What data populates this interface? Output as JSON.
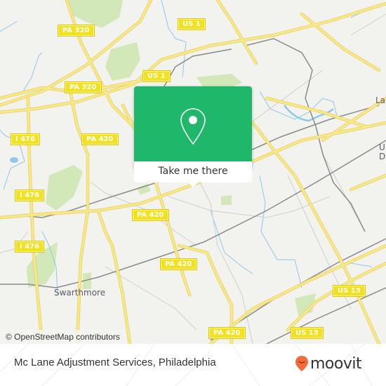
{
  "map": {
    "attribution": "© OpenStreetMap contributors",
    "colors": {
      "background": "#f2f2ef",
      "road": "#f6e27a",
      "road_edge": "#e6cf5a",
      "park": "#d3e8b8",
      "water": "#8fc8e8",
      "rail": "#8a8a8a",
      "minor_road": "#c8c8c8",
      "shield": "#f4e11d"
    },
    "route_shields": [
      {
        "id": "pa320-a",
        "label": "PA 320"
      },
      {
        "id": "pa320-b",
        "label": "PA 320"
      },
      {
        "id": "us1-a",
        "label": "US 1"
      },
      {
        "id": "us1-b",
        "label": "US 1"
      },
      {
        "id": "i476-a",
        "label": "I 476"
      },
      {
        "id": "i476-b",
        "label": "I 476"
      },
      {
        "id": "i476-c",
        "label": "I 476"
      },
      {
        "id": "pa420-a",
        "label": "PA 420"
      },
      {
        "id": "pa420-b",
        "label": "PA 420"
      },
      {
        "id": "pa420-c",
        "label": "PA 420"
      },
      {
        "id": "pa420-d",
        "label": "PA 420"
      },
      {
        "id": "us13-a",
        "label": "US 13"
      },
      {
        "id": "us13-b",
        "label": "US 13"
      }
    ],
    "place_labels": [
      {
        "id": "swarthmore",
        "label": "Swarthmore"
      },
      {
        "id": "la",
        "label": "La"
      },
      {
        "id": "u",
        "label": "U"
      },
      {
        "id": "d",
        "label": "D"
      }
    ]
  },
  "popup": {
    "icon": "map-pin-icon",
    "button_label": "Take me there",
    "accent_color": "#1fb86b"
  },
  "footer": {
    "title": "Mc Lane Adjustment Services, Philadelphia",
    "logo_text": "moovit",
    "logo_color": "#f26b3a"
  }
}
